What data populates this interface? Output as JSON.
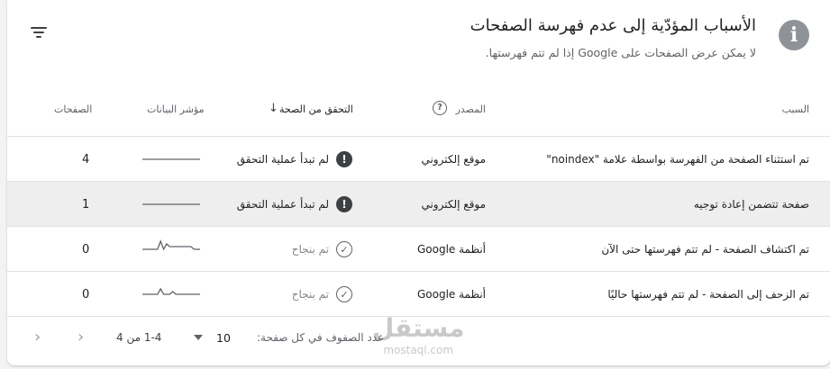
{
  "header": {
    "title": "الأسباب المؤدّية إلى عدم فهرسة الصفحات",
    "subtitle": "لا يمكن عرض الصفحات على Google إذا لم تتم فهرستها.",
    "info_icon": "info-icon",
    "filter_icon": "filter-icon"
  },
  "columns": {
    "reason": "السبب",
    "source": "المصدر",
    "validation": "التحقق من الصحة",
    "trend": "مؤشر البيانات",
    "pages": "الصفحات"
  },
  "rows": [
    {
      "reason": "تم استثناء الصفحة من الفهرسة بواسطة علامة \"noindex\"",
      "source": "موقع إلكتروني",
      "validation": "لم تبدأ عملية التحقق",
      "status": "warning",
      "pages": "4",
      "trend": [
        1,
        1,
        1,
        1,
        1,
        1,
        1,
        1,
        1,
        1,
        1,
        1,
        1,
        1,
        1,
        1,
        1,
        1,
        1,
        1
      ]
    },
    {
      "reason": "صفحة تتضمن إعادة توجيه",
      "source": "موقع إلكتروني",
      "validation": "لم تبدأ عملية التحقق",
      "status": "warning",
      "pages": "1",
      "trend": [
        1,
        1,
        1,
        1,
        1,
        1,
        1,
        1,
        1,
        1,
        1,
        1,
        1,
        1,
        1,
        1,
        1,
        1,
        1,
        1
      ]
    },
    {
      "reason": "تم اكتشاف الصفحة - لم تتم فهرستها حتى الآن",
      "source": "أنظمة Google",
      "validation": "تم بنجاح",
      "status": "passed",
      "pages": "0",
      "trend": [
        1,
        1,
        1,
        1,
        1,
        1,
        4,
        1,
        3,
        2,
        2,
        2,
        2,
        2,
        2,
        2,
        2,
        1,
        1,
        1
      ]
    },
    {
      "reason": "تم الزحف إلى الصفحة - لم تتم فهرستها حاليًا",
      "source": "أنظمة Google",
      "validation": "تم بنجاح",
      "status": "passed",
      "pages": "0",
      "trend": [
        1,
        1,
        1,
        1,
        1,
        1,
        3,
        1,
        1,
        1,
        2,
        1,
        1,
        1,
        1,
        1,
        1,
        1,
        1,
        1
      ]
    }
  ],
  "pagination": {
    "rows_per_page_label": "عدد الصفوف في كل صفحة:",
    "rows_per_page_value": "10",
    "range": "1-4 من 4",
    "prev_icon": "chevron-left-icon",
    "next_icon": "chevron-right-icon"
  },
  "watermark": {
    "logo": "مستقل",
    "url": "mostaql.com"
  },
  "colors": {
    "highlight_row": "#eeeeee",
    "sparkline": "#5f6368",
    "info_icon_bg": "#8f9398"
  }
}
